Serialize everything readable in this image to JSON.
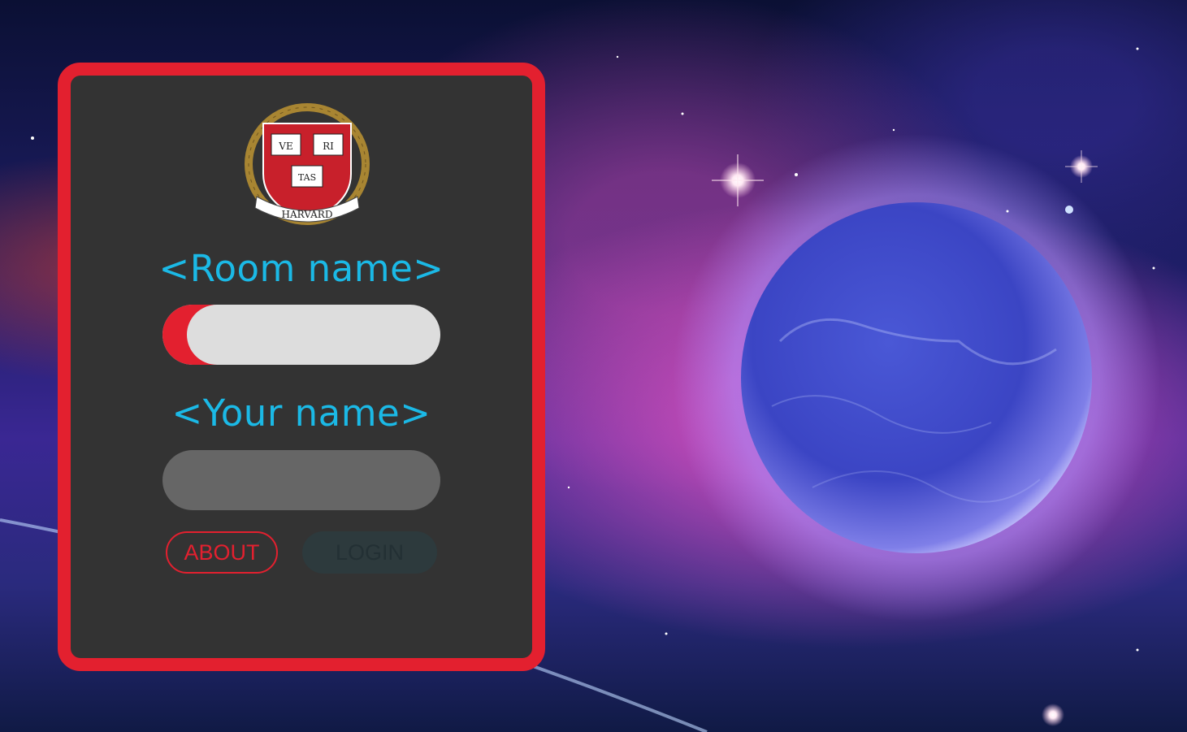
{
  "room_label": "<Room name>",
  "your_label": "<Your name>",
  "room_input": {
    "value": "",
    "placeholder": ""
  },
  "name_input": {
    "value": "",
    "placeholder": ""
  },
  "about_label": "ABOUT",
  "login_label": "LOGIN",
  "crest_text": {
    "ve": "VE",
    "ri": "RI",
    "tas": "TAS",
    "banner": "HARVARD"
  },
  "colors": {
    "accent_red": "#e3202f",
    "label_cyan": "#1bb9e6",
    "card_bg": "#333333"
  }
}
